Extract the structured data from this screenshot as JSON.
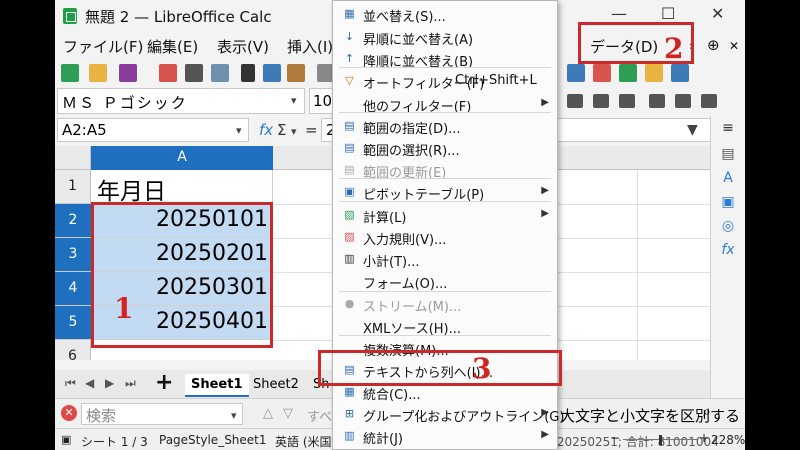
{
  "window": {
    "title": "無題 2 — LibreOffice Calc",
    "minimize": "—",
    "maximize": "☐",
    "close": "✕"
  },
  "menubar": [
    "ファイル(F)",
    "編集(E)",
    "表示(V)",
    "挿入(I)",
    "データ(D)"
  ],
  "font": {
    "name": "ＭＳ Ｐゴシック",
    "size": "10"
  },
  "formula": {
    "namebox": "A2:A5",
    "fx": "fx",
    "sum": "Σ",
    "sum_dd": "▾",
    "eq": "=",
    "content": "2"
  },
  "sheet": {
    "column_header": "A",
    "row_numbers": [
      "1",
      "2",
      "3",
      "4",
      "5",
      "6"
    ],
    "cells": [
      "年月日",
      "20250101",
      "20250201",
      "20250301",
      "20250401"
    ]
  },
  "data_menu": {
    "items": [
      {
        "label": "並べ替え(S)...",
        "icon": "sort-icon",
        "glyph": "▦",
        "shortcut": "",
        "submenu": false,
        "disabled": false
      },
      {
        "label": "昇順に並べ替え(A)",
        "icon": "sort-ascending-icon",
        "glyph": "↓",
        "shortcut": "",
        "submenu": false,
        "disabled": false
      },
      {
        "label": "降順に並べ替え(B)",
        "icon": "sort-descending-icon",
        "glyph": "↑",
        "shortcut": "",
        "submenu": false,
        "disabled": false
      },
      {
        "label": "オートフィルター(F)",
        "icon": "autofilter-icon",
        "glyph": "▽",
        "shortcut": "Ctrl+Shift+L",
        "submenu": false,
        "disabled": false
      },
      {
        "label": "他のフィルター(F)",
        "icon": "",
        "glyph": "",
        "shortcut": "",
        "submenu": true,
        "disabled": false
      },
      {
        "label": "範囲の指定(D)...",
        "icon": "define-range-icon",
        "glyph": "▤",
        "shortcut": "",
        "submenu": false,
        "disabled": false
      },
      {
        "label": "範囲の選択(R)...",
        "icon": "select-range-icon",
        "glyph": "▤",
        "shortcut": "",
        "submenu": false,
        "disabled": false
      },
      {
        "label": "範囲の更新(E)",
        "icon": "refresh-range-icon",
        "glyph": "▤",
        "shortcut": "",
        "submenu": false,
        "disabled": true
      },
      {
        "label": "ピボットテーブル(P)",
        "icon": "pivot-table-icon",
        "glyph": "▣",
        "shortcut": "",
        "submenu": true,
        "disabled": false
      },
      {
        "label": "計算(L)",
        "icon": "calculate-icon",
        "glyph": "▧",
        "shortcut": "",
        "submenu": true,
        "disabled": false
      },
      {
        "label": "入力規則(V)...",
        "icon": "validity-icon",
        "glyph": "▨",
        "shortcut": "",
        "submenu": false,
        "disabled": false
      },
      {
        "label": "小計(T)...",
        "icon": "subtotals-icon",
        "glyph": "▥",
        "shortcut": "",
        "submenu": false,
        "disabled": false
      },
      {
        "label": "フォーム(O)...",
        "icon": "",
        "glyph": "",
        "shortcut": "",
        "submenu": false,
        "disabled": false
      },
      {
        "label": "ストリーム(M)...",
        "icon": "streams-icon",
        "glyph": "●",
        "shortcut": "",
        "submenu": false,
        "disabled": true
      },
      {
        "label": "XMLソース(H)...",
        "icon": "",
        "glyph": "",
        "shortcut": "",
        "submenu": false,
        "disabled": false
      },
      {
        "label": "複数演算(M)...",
        "icon": "",
        "glyph": "",
        "shortcut": "",
        "submenu": false,
        "disabled": false
      },
      {
        "label": "テキストから列へ(I)...",
        "icon": "text-to-columns-icon",
        "glyph": "▤",
        "shortcut": "",
        "submenu": false,
        "disabled": false
      },
      {
        "label": "統合(C)...",
        "icon": "consolidate-icon",
        "glyph": "▦",
        "shortcut": "",
        "submenu": false,
        "disabled": false
      },
      {
        "label": "グループ化およびアウトライン(G)",
        "icon": "group-outline-icon",
        "glyph": "⊞",
        "shortcut": "",
        "submenu": true,
        "disabled": false
      },
      {
        "label": "統計(J)",
        "icon": "statistics-icon",
        "glyph": "▥",
        "shortcut": "",
        "submenu": true,
        "disabled": false
      }
    ]
  },
  "sheet_tabs": [
    "Sheet1",
    "Sheet2",
    "Sh"
  ],
  "add_sheet": "+",
  "find": {
    "placeholder": "検索",
    "close": "✕",
    "up_arrow": "△",
    "down_arrow": "▽",
    "all_label": "すべ",
    "match_case_label": "大文字と小文字を区別する"
  },
  "status": {
    "sheet": "シート 1 / 3",
    "page_style": "PageStyle_Sheet1",
    "language": "英語 (米国)",
    "sum_text": "平均: 20250251; 合計: 81001004",
    "zoom": "228%",
    "zoom_minus": "−",
    "zoom_plus": "+"
  },
  "annotations": [
    "1",
    "2",
    "3"
  ],
  "colors": {
    "selection_header": "#1f6fbf",
    "selection_fill": "#c2dbf3",
    "annotation_red": "#cc2a2a"
  }
}
